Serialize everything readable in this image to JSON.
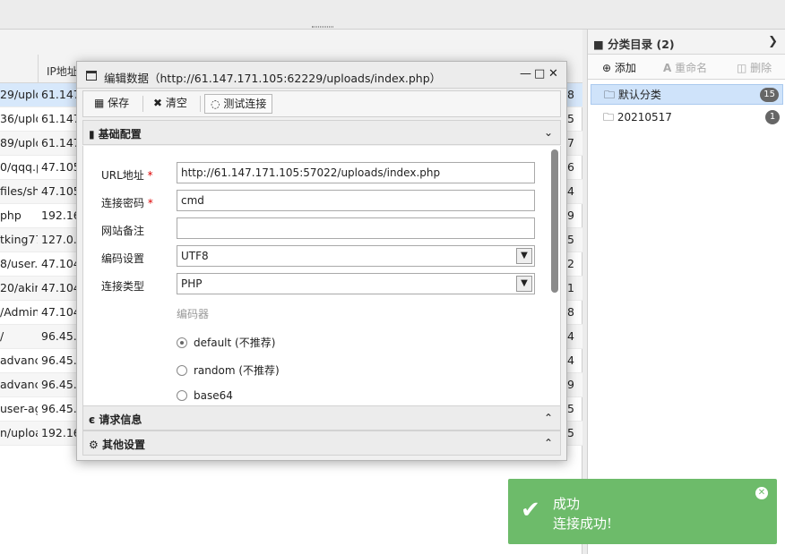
{
  "table": {
    "ip_header": "IP地址",
    "rows": [
      {
        "url": "29/uplo",
        "ip": "61.147",
        "count": "8",
        "state": "sel"
      },
      {
        "url": "36/uplo",
        "ip": "61.147",
        "count": "5",
        "state": ""
      },
      {
        "url": "89/uplo",
        "ip": "61.147",
        "count": "7",
        "state": "alt"
      },
      {
        "url": "0/qqq.p",
        "ip": "47.105",
        "count": "6",
        "state": ""
      },
      {
        "url": "files/she",
        "ip": "47.105",
        "count": "4",
        "state": "alt"
      },
      {
        "url": "php",
        "ip": "192.16",
        "count": "9",
        "state": ""
      },
      {
        "url": "tking77",
        "ip": "127.0.0",
        "count": "5",
        "state": "alt"
      },
      {
        "url": "8/user.p",
        "ip": "47.104",
        "count": "2",
        "state": ""
      },
      {
        "url": "20/akin",
        "ip": "47.104",
        "count": "1",
        "state": "alt"
      },
      {
        "url": "/Admini",
        "ip": "47.104",
        "count": "8",
        "state": ""
      },
      {
        "url": "/",
        "ip": "96.45.",
        "count": "4",
        "state": "alt"
      },
      {
        "url": "advance",
        "ip": "96.45.",
        "count": "4",
        "state": ""
      },
      {
        "url": "advance",
        "ip": "96.45.",
        "count": "9",
        "state": "alt"
      },
      {
        "url": "user-ag",
        "ip": "96.45.",
        "count": "5",
        "state": ""
      },
      {
        "url": "n/uploa",
        "ip": "192.16",
        "count": "5",
        "state": "alt"
      }
    ]
  },
  "category": {
    "title": "分类目录 (2)",
    "add": "添加",
    "rename": "重命名",
    "delete": "删除",
    "items": [
      {
        "label": "默认分类",
        "count": "15"
      },
      {
        "label": "20210517",
        "count": "1"
      }
    ]
  },
  "dialog": {
    "title": "编辑数据（http://61.147.171.105:62229/uploads/index.php）",
    "save": "保存",
    "clear": "清空",
    "test": "测试连接",
    "basic_section": "基础配置",
    "request_section": "请求信息",
    "other_section": "其他设置",
    "fields": {
      "url_label": "URL地址",
      "url_value": "http://61.147.171.105:57022/uploads/index.php",
      "pwd_label": "连接密码",
      "pwd_value": "cmd",
      "note_label": "网站备注",
      "note_value": "",
      "enc_label": "编码设置",
      "enc_value": "UTF8",
      "type_label": "连接类型",
      "type_value": "PHP"
    },
    "encoder_title": "编码器",
    "encoders": [
      "default (不推荐)",
      "random (不推荐)",
      "base64"
    ],
    "selected_encoder": "default (不推荐)"
  },
  "toast": {
    "title": "成功",
    "message": "连接成功!"
  },
  "colors": {
    "toast_bg": "#6dbb6a",
    "selected_row": "#d7e8fb",
    "required": "#dd0000"
  }
}
